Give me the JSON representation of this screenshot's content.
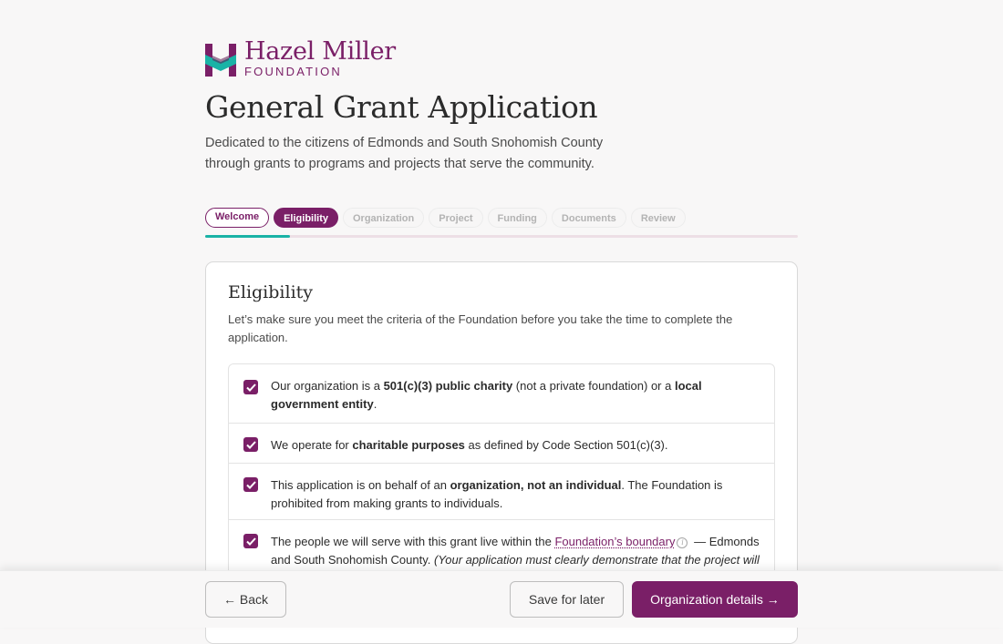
{
  "brand": {
    "name": "Hazel Miller",
    "sub": "FOUNDATION",
    "colors": {
      "primary": "#7a1f67",
      "accent": "#1ab3a6"
    }
  },
  "page": {
    "title": "General Grant Application",
    "subtitle": "Dedicated to the citizens of Edmonds and South Snohomish County through grants to programs and projects that serve the community."
  },
  "steps": [
    {
      "label": "Welcome",
      "state": "done"
    },
    {
      "label": "Eligibility",
      "state": "active"
    },
    {
      "label": "Organization",
      "state": "upcoming"
    },
    {
      "label": "Project",
      "state": "upcoming"
    },
    {
      "label": "Funding",
      "state": "upcoming"
    },
    {
      "label": "Documents",
      "state": "upcoming"
    },
    {
      "label": "Review",
      "state": "upcoming"
    }
  ],
  "progress": {
    "fraction": 0.143
  },
  "card": {
    "title": "Eligibility",
    "intro": "Let’s make sure you meet the criteria of the Foundation before you take the time to complete the application.",
    "items": [
      {
        "checked": true,
        "t1": "Our organization is a ",
        "b1": "501(c)(3) public charity",
        "t2": " (not a private foundation) or a ",
        "b2": "local government entity",
        "t3": "."
      },
      {
        "checked": true,
        "t1": "We operate for ",
        "b1": "charitable purposes",
        "t2": " as defined by Code Section 501(c)(3)."
      },
      {
        "checked": true,
        "t1": "This application is on behalf of an ",
        "b1": "organization, not an individual",
        "t2": ". The Foundation is prohibited from making grants to individuals."
      },
      {
        "checked": true,
        "t1": "The people we will serve with this grant live within the ",
        "link": "Foundation’s boundary",
        "info_icon": "info-circle-icon",
        "t2": " — Edmonds and South Snohomish County. ",
        "i1": "(Your application must clearly demonstrate that the project will serve people within the boundary.)"
      }
    ]
  },
  "footer": {
    "back_label": "← Back",
    "save_label": "Save for later",
    "next_label": "Organization details →"
  }
}
